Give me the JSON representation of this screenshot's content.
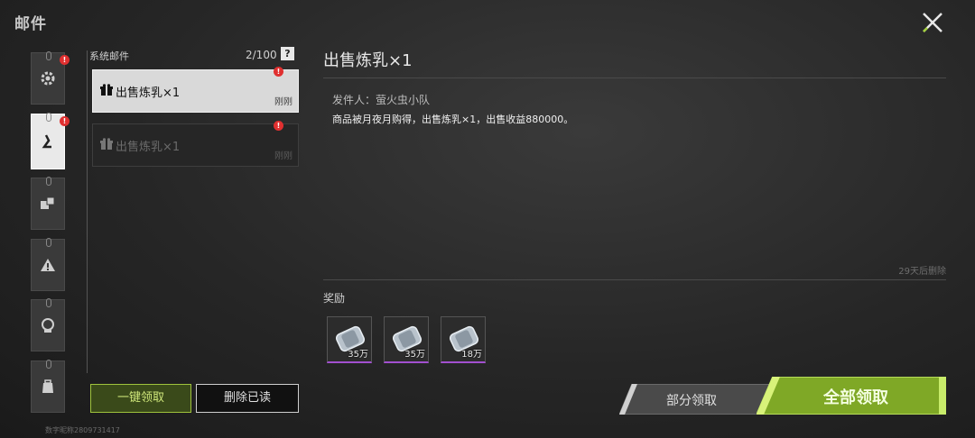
{
  "header": {
    "title": "邮件"
  },
  "colors": {
    "accent": "#a4d23c",
    "alert": "#e03030",
    "rarity": "#a24fd0"
  },
  "sidebar": {
    "categories": [
      {
        "icon": "gear-icon",
        "badge": "!"
      },
      {
        "icon": "person-icon",
        "badge": "!"
      },
      {
        "icon": "dice-icon"
      },
      {
        "icon": "warning-icon"
      },
      {
        "icon": "avatar-icon"
      },
      {
        "icon": "backpack-icon"
      }
    ]
  },
  "mail_list": {
    "label": "系统邮件",
    "count": "2/100",
    "help": "?",
    "items": [
      {
        "title": "出售炼乳×1",
        "time": "刚刚",
        "badge": "!"
      },
      {
        "title": "出售炼乳×1",
        "time": "刚刚",
        "badge": "!"
      }
    ],
    "claim_all_label": "一键领取",
    "delete_read_label": "删除已读"
  },
  "footer": {
    "user_id": "数字昵称2809731417"
  },
  "detail": {
    "title": "出售炼乳×1",
    "sender": "发件人：萤火虫小队",
    "body": "商品被月夜月购得，出售炼乳×1，出售收益880000。",
    "expire": "29天后删除",
    "reward_label": "奖励",
    "rewards": [
      {
        "amount": "35万"
      },
      {
        "amount": "35万"
      },
      {
        "amount": "18万"
      }
    ],
    "partial_claim_label": "部分领取",
    "claim_all_label": "全部领取"
  }
}
